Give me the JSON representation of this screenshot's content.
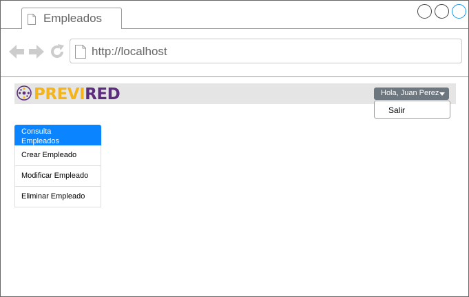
{
  "browser": {
    "tab_title": "Empleados",
    "url": "http://localhost",
    "accent_color": "#1c94e3"
  },
  "header": {
    "logo_part1": "PREVI",
    "logo_part2": "RED",
    "logo_colors": {
      "primary": "#f4b41a",
      "secondary": "#5c2d7e"
    },
    "user_menu_label": "Hola, Juan Perez",
    "user_menu_items": [
      "Salir"
    ]
  },
  "sidebar": {
    "items": [
      {
        "label": "Consulta Empleados",
        "active": true
      },
      {
        "label": "Crear Empleado",
        "active": false
      },
      {
        "label": "Modificar Empleado",
        "active": false
      },
      {
        "label": "Eliminar Empleado",
        "active": false
      }
    ],
    "active_color": "#0a85ff"
  },
  "icons": {
    "back": "arrow-left-icon",
    "forward": "arrow-right-icon",
    "reload": "reload-icon",
    "page": "page-icon"
  }
}
